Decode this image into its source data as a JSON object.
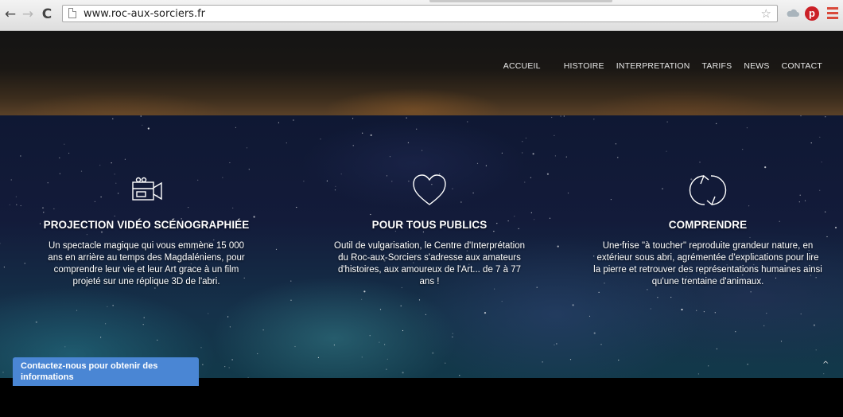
{
  "browser": {
    "back_glyph": "←",
    "forward_glyph": "→",
    "reload_glyph": "C",
    "url": "www.roc-aux-sorciers.fr",
    "star_glyph": "☆",
    "extensions": [
      "cloud-icon",
      "pinterest-icon"
    ],
    "pinterest_glyph": "p",
    "menu_icon": "hamburger-menu-icon",
    "colors": {
      "pinterest": "#cb2027",
      "menu": "#d94a3b"
    }
  },
  "nav": {
    "items": [
      "ACCUEIL",
      "HISTOIRE",
      "INTERPRETATION",
      "TARIFS",
      "NEWS",
      "CONTACT"
    ]
  },
  "features": [
    {
      "icon": "video-camera-icon",
      "title": "PROJECTION VIDÉO SCÉNOGRAPHIÉE",
      "text": "Un spectacle magique qui vous emmène 15 000 ans en arrière au temps des Magdaléniens, pour comprendre leur vie et leur Art grace à un film projeté sur une réplique 3D de l'abri."
    },
    {
      "icon": "heart-icon",
      "title": "POUR TOUS PUBLICS",
      "text": "Outil de vulgarisation, le Centre d'Interprétation du Roc-aux-Sorciers s'adresse aux amateurs d'histoires, aux amoureux de l'Art... de 7 à 77 ans !"
    },
    {
      "icon": "refresh-icon",
      "title": "COMPRENDRE",
      "text": "Une frise \"à toucher\" reproduite grandeur nature, en extérieur sous abri, agrémentée d'explications pour lire la pierre et retrouver des représentations humaines ainsi qu'une trentaine d'animaux."
    }
  ],
  "contact_tab": {
    "label": "Contactez-nous pour obtenir des informations",
    "color": "#4a86d4"
  },
  "scroll_top": {
    "glyph": "^"
  }
}
